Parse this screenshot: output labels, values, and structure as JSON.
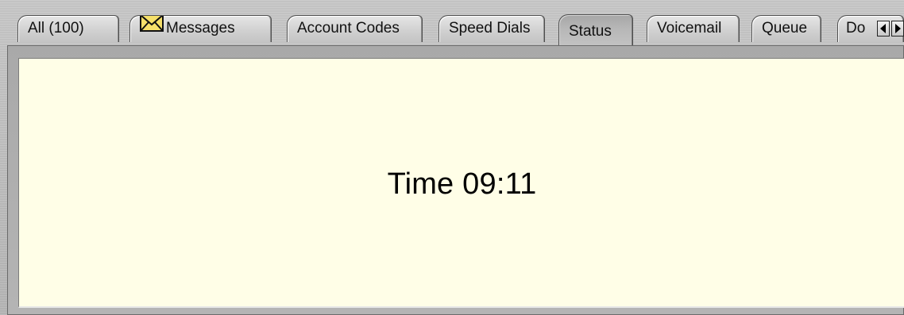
{
  "tabs": [
    {
      "id": "all",
      "label": "All (100)"
    },
    {
      "id": "messages",
      "label": "Messages",
      "icon": "envelope-icon"
    },
    {
      "id": "account-codes",
      "label": "Account Codes"
    },
    {
      "id": "speed-dials",
      "label": "Speed Dials"
    },
    {
      "id": "status",
      "label": "Status",
      "active": true
    },
    {
      "id": "voicemail",
      "label": "Voicemail"
    },
    {
      "id": "queue",
      "label": "Queue"
    },
    {
      "id": "do",
      "label": "Do"
    }
  ],
  "scroll": {
    "left_icon": "arrow-left-icon",
    "right_icon": "arrow-right-icon"
  },
  "status_panel": {
    "time_text": "Time 09:11"
  },
  "colors": {
    "panel_background": "#fffee7",
    "chrome_background": "#b8b8b8",
    "envelope_fill": "#f6e06a"
  }
}
